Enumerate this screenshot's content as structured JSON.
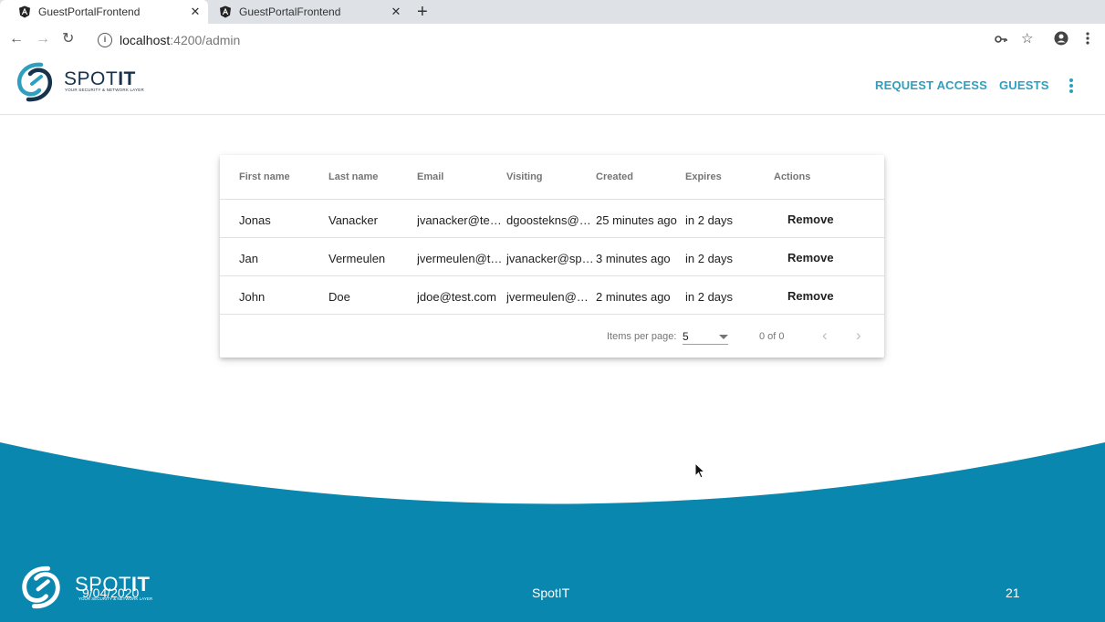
{
  "browser": {
    "tabs": [
      {
        "title": "GuestPortalFrontend",
        "active": true
      },
      {
        "title": "GuestPortalFrontend",
        "active": false
      }
    ],
    "url_host": "localhost",
    "url_path": ":4200/admin"
  },
  "app": {
    "logo_main": "SPOT",
    "logo_bold": "IT",
    "logo_tagline": "YOUR SECURITY & NETWORK LAYER",
    "nav": {
      "request_access": "REQUEST ACCESS",
      "guests": "GUESTS"
    }
  },
  "table": {
    "headers": [
      "First name",
      "Last name",
      "Email",
      "Visiting",
      "Created",
      "Expires",
      "Actions"
    ],
    "rows": [
      {
        "first": "Jonas",
        "last": "Vanacker",
        "email": "jvanacker@test.com",
        "visiting": "dgoostekns@spotit.be",
        "created": "25 minutes ago",
        "expires": "in 2 days",
        "action": "Remove"
      },
      {
        "first": "Jan",
        "last": "Vermeulen",
        "email": "jvermeulen@test.com",
        "visiting": "jvanacker@spotit.be",
        "created": "3 minutes ago",
        "expires": "in 2 days",
        "action": "Remove"
      },
      {
        "first": "John",
        "last": "Doe",
        "email": "jdoe@test.com",
        "visiting": "jvermeulen@spotit.be",
        "created": "2 minutes ago",
        "expires": "in 2 days",
        "action": "Remove"
      }
    ],
    "paginator": {
      "label": "Items per page:",
      "page_size": "5",
      "range": "0 of 0"
    }
  },
  "footer": {
    "date": "9/04/2020",
    "name": "SpotIT",
    "page": "21"
  },
  "colors": {
    "accent": "#2f9fc0",
    "footer_blue": "#0a87ae",
    "logo_dark": "#17324d"
  }
}
